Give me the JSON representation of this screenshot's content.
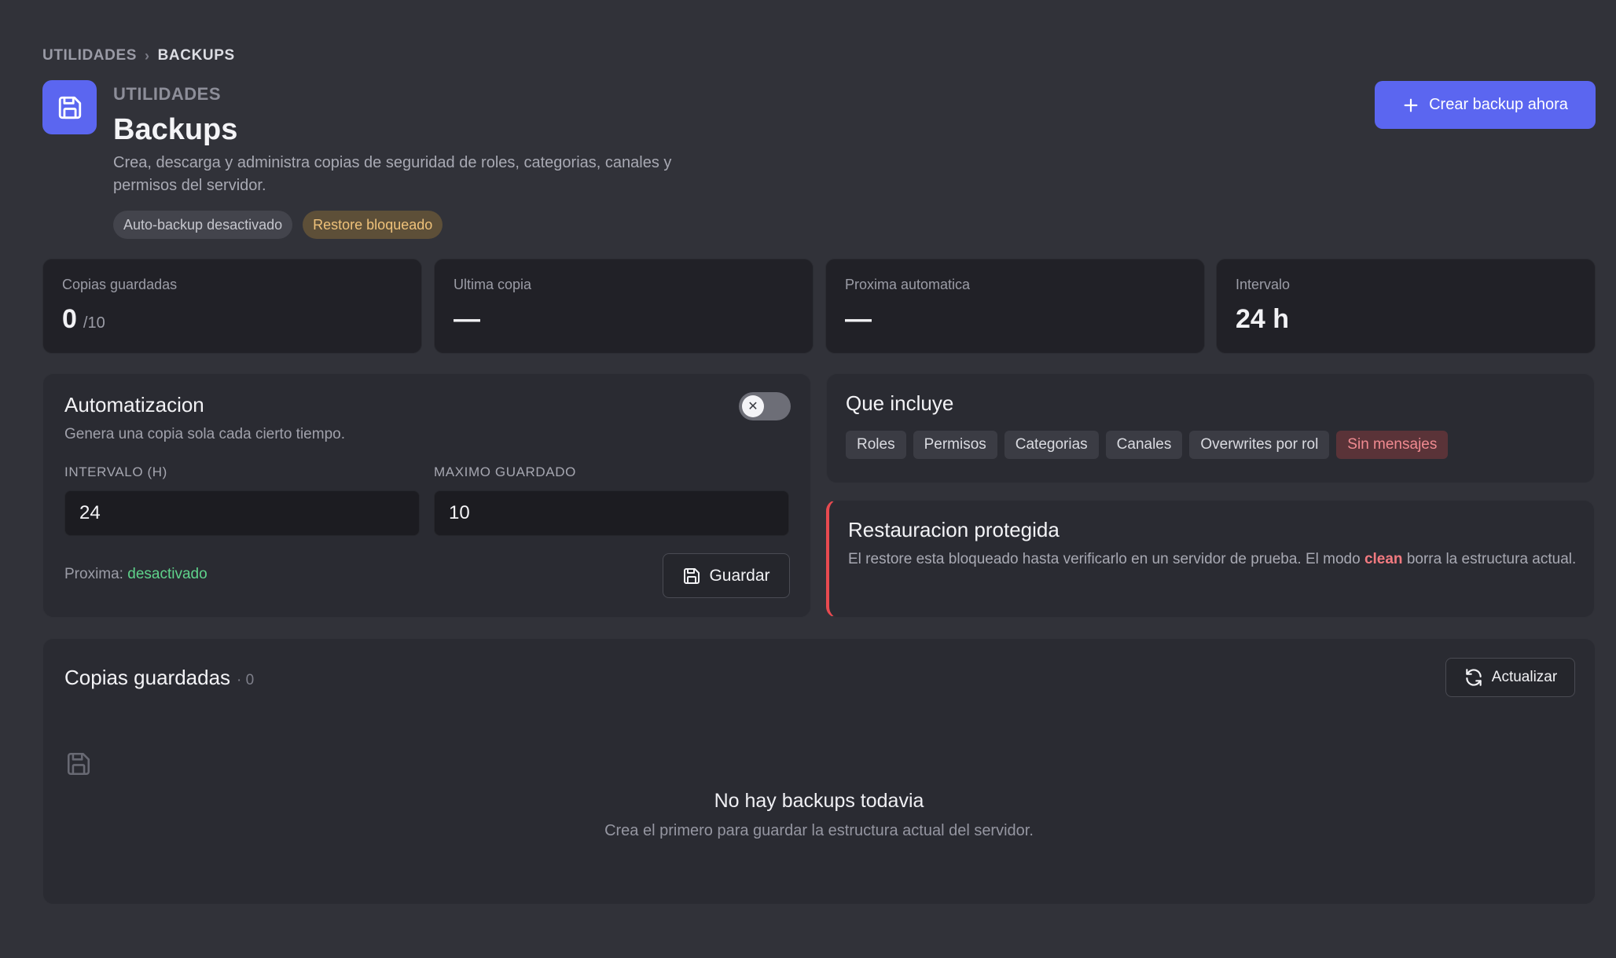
{
  "breadcrumb": {
    "parent": "UTILIDADES",
    "separator": "›",
    "current": "BACKUPS"
  },
  "header": {
    "eyebrow": "UTILIDADES",
    "title": "Backups",
    "description": "Crea, descarga y administra copias de seguridad de roles, categorias, canales y permisos del servidor.",
    "badges": [
      {
        "label": "Auto-backup desactivado",
        "tone": "neutral"
      },
      {
        "label": "Restore bloqueado",
        "tone": "warning"
      }
    ],
    "primary_button": "Crear backup ahora"
  },
  "stats": [
    {
      "label": "Copias guardadas",
      "value": "0",
      "sub": "/10"
    },
    {
      "label": "Ultima copia",
      "value": "—",
      "sub": ""
    },
    {
      "label": "Proxima automatica",
      "value": "—",
      "sub": ""
    },
    {
      "label": "Intervalo",
      "value": "24 h",
      "sub": ""
    }
  ],
  "automation": {
    "title": "Automatizacion",
    "description": "Genera una copia sola cada cierto tiempo.",
    "enabled": false,
    "interval_label": "INTERVALO (H)",
    "interval_value": "24",
    "max_label": "MAXIMO GUARDADO",
    "max_value": "10",
    "next_label": "Proxima:",
    "next_value": "desactivado",
    "save_button": "Guardar"
  },
  "includes": {
    "title": "Que incluye",
    "items": [
      "Roles",
      "Permisos",
      "Categorias",
      "Canales",
      "Overwrites por rol",
      "Sin mensajes"
    ]
  },
  "restore": {
    "title": "Restauracion protegida",
    "text_before": "El restore esta bloqueado hasta verificarlo en un servidor de prueba. El modo",
    "highlight": "clean",
    "text_after": "borra la estructura actual."
  },
  "saved_list": {
    "title": "Copias guardadas",
    "count": "· 0",
    "refresh_button": "Actualizar",
    "empty_title": "No hay backups todavia",
    "empty_sub": "Crea el primero para guardar la estructura actual del servidor."
  },
  "colors": {
    "background": "#313239",
    "accent": "#5b66f0",
    "warning": "#efc27a",
    "danger": "#e84a50",
    "success": "#5fd38b"
  }
}
